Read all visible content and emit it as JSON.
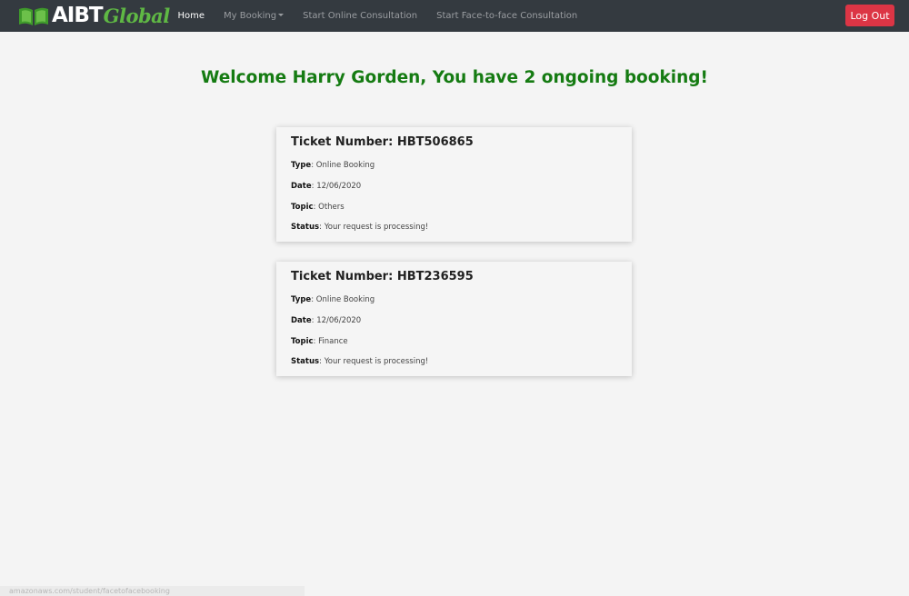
{
  "nav": {
    "brand_part1": "AIBT",
    "brand_part2": "Global",
    "links": [
      {
        "label": "Home"
      },
      {
        "label": "My Booking"
      },
      {
        "label": "Start Online Consultation"
      },
      {
        "label": "Start Face-to-face Consultation"
      }
    ],
    "logout_label": "Log Out"
  },
  "welcome": "Welcome Harry Gorden, You have 2 ongoing booking!",
  "field_labels": {
    "type": "Type",
    "date": "Date",
    "topic": "Topic",
    "status": "Status"
  },
  "tickets": [
    {
      "title": "Ticket Number: HBT506865",
      "type": "Online Booking",
      "date": "12/06/2020",
      "topic": "Others",
      "status": "Your request is processing!"
    },
    {
      "title": "Ticket Number: HBT236595",
      "type": "Online Booking",
      "date": "12/06/2020",
      "topic": "Finance",
      "status": "Your request is processing!"
    }
  ],
  "status_bar_url": "amazonaws.com/student/facetofacebooking",
  "colors": {
    "navbar": "#343a40",
    "accent_green": "#157b12",
    "logo_green": "#5fb844",
    "logout_red": "#dc3545"
  }
}
